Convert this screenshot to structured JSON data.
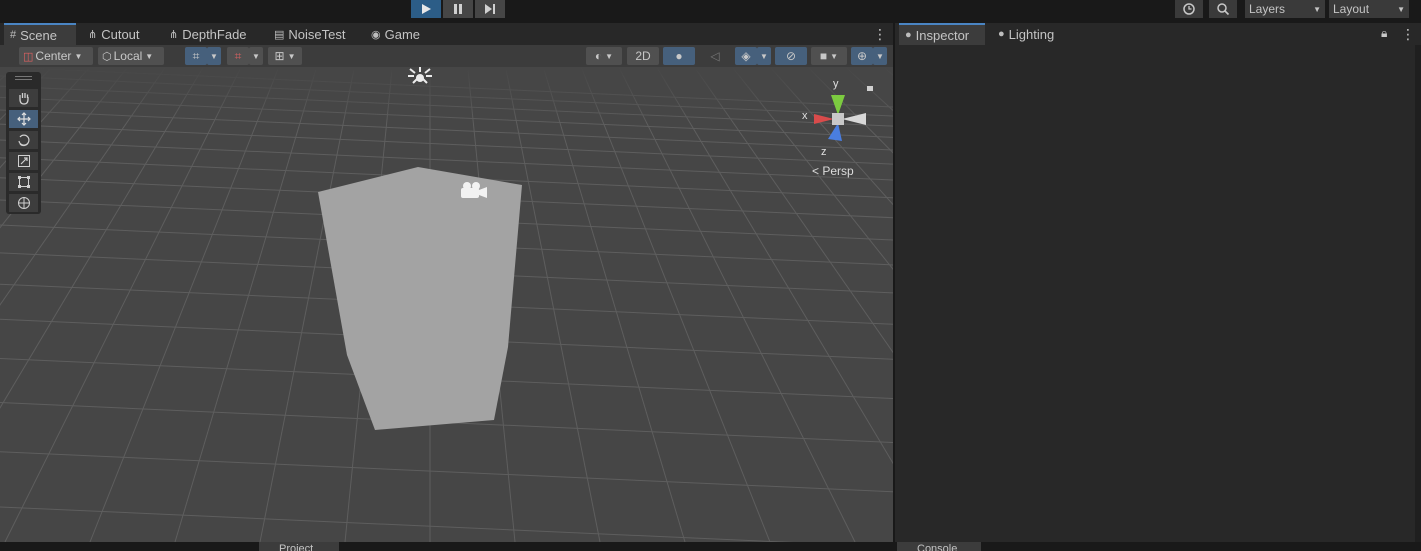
{
  "toolbar": {
    "play_icon": "play-icon",
    "pause_icon": "pause-icon",
    "step_icon": "step-icon",
    "history_icon": "history-icon",
    "search_icon": "search-icon",
    "layers_label": "Layers",
    "layout_label": "Layout"
  },
  "scene_tabs": [
    {
      "label": "Scene",
      "icon": "grid-icon"
    },
    {
      "label": "Cutout",
      "icon": "hierarchy-icon"
    },
    {
      "label": "DepthFade",
      "icon": "hierarchy-icon"
    },
    {
      "label": "NoiseTest",
      "icon": "document-icon"
    },
    {
      "label": "Game",
      "icon": "gamepad-icon"
    }
  ],
  "inspector_tabs": [
    {
      "label": "Inspector",
      "icon": "info-icon"
    },
    {
      "label": "Lighting",
      "icon": "bulb-icon"
    }
  ],
  "scene_toolbar": {
    "pivot_label": "Center",
    "space_label": "Local",
    "mode_2d_label": "2D"
  },
  "gizmo": {
    "x_label": "x",
    "y_label": "y",
    "z_label": "z",
    "projection_label": "Persp"
  },
  "bottom_tabs": {
    "project_label": "Project",
    "console_label": "Console"
  },
  "colors": {
    "accent": "#2c5d87",
    "tab_highlight": "#4a85c4",
    "axis_x": "#d94b4b",
    "axis_y": "#7ccb40",
    "axis_z": "#4a7ee0"
  }
}
